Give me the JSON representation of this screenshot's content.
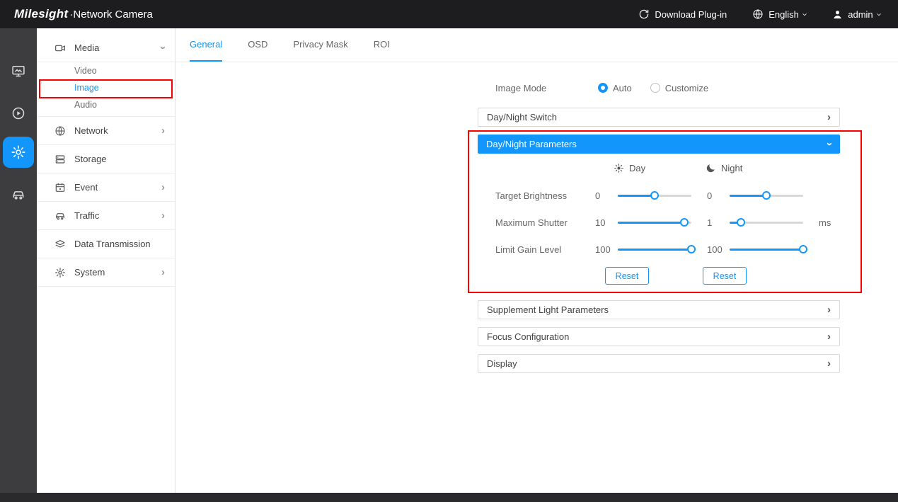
{
  "colors": {
    "accent": "#1296fb",
    "annotation": "#ff0000",
    "topbar_bg": "#1d1d1f",
    "rail_bg": "#3d3d40"
  },
  "topbar": {
    "brand": "Milesight",
    "product": "·Network Camera",
    "download_plugin": "Download Plug-in",
    "language": "English",
    "user": "admin"
  },
  "icons": {
    "chevron_right": "›",
    "download_plugin": "circular-refresh-arrow",
    "language": "globe",
    "user": "person",
    "rail": [
      "live-view-monitor",
      "playback-play-circle",
      "settings-gear",
      "traffic-car"
    ],
    "sun": "sun",
    "moon": "moon-crescent"
  },
  "sidebar": {
    "media": {
      "label": "Media",
      "expanded": true,
      "children": [
        {
          "label": "Video",
          "active": false
        },
        {
          "label": "Image",
          "active": true
        },
        {
          "label": "Audio",
          "active": false
        }
      ]
    },
    "items": [
      {
        "label": "Network",
        "has_children": true
      },
      {
        "label": "Storage",
        "has_children": false
      },
      {
        "label": "Event",
        "has_children": true
      },
      {
        "label": "Traffic",
        "has_children": true
      },
      {
        "label": "Data Transmission",
        "has_children": false
      },
      {
        "label": "System",
        "has_children": true
      }
    ]
  },
  "tabs": {
    "items": [
      {
        "label": "General",
        "active": true
      },
      {
        "label": "OSD",
        "active": false
      },
      {
        "label": "Privacy Mask",
        "active": false
      },
      {
        "label": "ROI",
        "active": false
      }
    ]
  },
  "image_mode": {
    "label": "Image Mode",
    "options": [
      {
        "label": "Auto",
        "selected": true
      },
      {
        "label": "Customize",
        "selected": false
      }
    ]
  },
  "accordion": {
    "day_night_switch": "Day/Night Switch",
    "supplement_light": "Supplement Light Parameters",
    "focus_configuration": "Focus Configuration",
    "display": "Display"
  },
  "day_night_parameters": {
    "title": "Day/Night Parameters",
    "expanded": true,
    "day_header": "Day",
    "night_header": "Night",
    "rows": [
      {
        "label": "Target Brightness",
        "day_value": "0",
        "day_pct": 50,
        "night_value": "0",
        "night_pct": 50,
        "unit": ""
      },
      {
        "label": "Maximum Shutter",
        "day_value": "10",
        "day_pct": 90,
        "night_value": "1",
        "night_pct": 15,
        "unit": "ms"
      },
      {
        "label": "Limit Gain Level",
        "day_value": "100",
        "day_pct": 100,
        "night_value": "100",
        "night_pct": 100,
        "unit": ""
      }
    ],
    "reset": "Reset"
  }
}
